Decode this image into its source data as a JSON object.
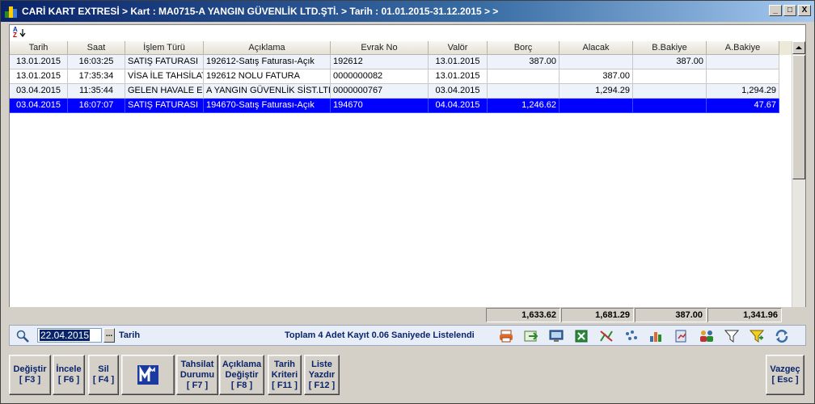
{
  "window": {
    "title": "CARİ KART EXTRESİ > Kart : MA0715-A YANGIN GÜVENLİK LTD.ŞTİ. > Tarih : 01.01.2015-31.12.2015 >  >",
    "minimize": "_",
    "maximize": "□",
    "close": "X"
  },
  "grid": {
    "sort_icon_top": "A",
    "sort_icon_bottom": "Z",
    "columns": [
      "Tarih",
      "Saat",
      "İşlem Türü",
      "Açıklama",
      "Evrak No",
      "Valör",
      "Borç",
      "Alacak",
      "B.Bakiye",
      "A.Bakiye"
    ],
    "rows": [
      [
        "13.01.2015",
        "16:03:25",
        "SATIŞ FATURASI",
        "192612-Satış Faturası-Açık",
        "192612",
        "13.01.2015",
        "387.00",
        "",
        "387.00",
        ""
      ],
      [
        "13.01.2015",
        "17:35:34",
        "VİSA İLE TAHSİLAT",
        "192612 NOLU FATURA",
        "0000000082",
        "13.01.2015",
        "",
        "387.00",
        "",
        ""
      ],
      [
        "03.04.2015",
        "11:35:44",
        "GELEN HAVALE EFT",
        "A YANGIN GÜVENLİK SİST.LTD.ŞTİ.",
        "0000000767",
        "03.04.2015",
        "",
        "1,294.29",
        "",
        "1,294.29"
      ],
      [
        "03.04.2015",
        "16:07:07",
        "SATIŞ FATURASI",
        "194670-Satış Faturası-Açık",
        "194670",
        "04.04.2015",
        "1,246.62",
        "",
        "",
        "47.67"
      ]
    ],
    "selected_row": 3
  },
  "totals": {
    "borc": "1,633.62",
    "alacak": "1,681.29",
    "b_bakiye": "387.00",
    "a_bakiye": "1,341.96"
  },
  "filter": {
    "date_value": "22.04.2015",
    "dots_label": "...",
    "date_label": "Tarih",
    "status": "Toplam 4 Adet Kayıt 0.06 Saniyede Listelendi"
  },
  "buttons": {
    "degistir": {
      "line1": "Değiştir",
      "line2": "[ F3 ]"
    },
    "incele": {
      "line1": "İncele",
      "line2": "[ F6 ]"
    },
    "sil": {
      "line1": "Sil",
      "line2": "[ F4 ]"
    },
    "tahsilat": {
      "line1": "Tahsilat",
      "line2": "Durumu",
      "line3": "[ F7 ]"
    },
    "aciklama": {
      "line1": "Açıklama",
      "line2": "Değiştir",
      "line3": "[ F8 ]"
    },
    "tarih_kriteri": {
      "line1": "Tarih",
      "line2": "Kriteri",
      "line3": "[ F11 ]"
    },
    "liste_yazdir": {
      "line1": "Liste",
      "line2": "Yazdır",
      "line3": "[ F12 ]"
    },
    "vazgec": {
      "line1": "Vazgeç",
      "line2": "[ Esc ]"
    }
  },
  "colors": {
    "selection": "#0000ff",
    "title_start": "#0a246a",
    "label_blue": "#0a246a"
  }
}
